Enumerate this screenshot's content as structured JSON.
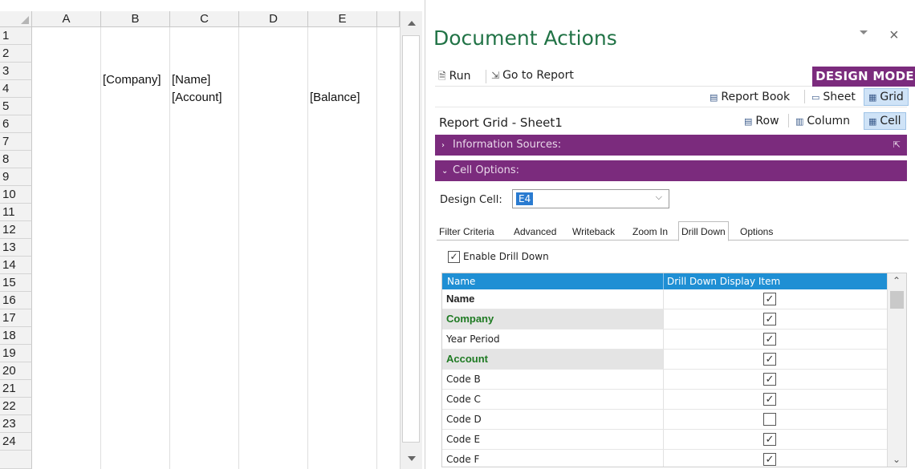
{
  "sheet": {
    "columns": [
      "A",
      "B",
      "C",
      "D",
      "E"
    ],
    "rows": [
      "1",
      "2",
      "3",
      "4",
      "5",
      "6",
      "7",
      "8",
      "9",
      "10",
      "11",
      "12",
      "13",
      "14",
      "15",
      "16",
      "17",
      "18",
      "19",
      "20",
      "21",
      "22",
      "23",
      "24"
    ],
    "cells": {
      "b3": "[Company]",
      "c3": "[Name]",
      "c4": "[Account]",
      "e4": "[Balance]"
    }
  },
  "pane": {
    "title": "Document Actions",
    "close_glyph": "×",
    "toolbar": {
      "run_label": "Run",
      "goto_label": "Go to Report",
      "mode_label": "DESIGN MODE"
    },
    "view": {
      "report_book_label": "Report Book",
      "sheet_label": "Sheet",
      "grid_label": "Grid"
    },
    "grid_header": {
      "title": "Report Grid - Sheet1",
      "row_label": "Row",
      "column_label": "Column",
      "cell_label": "Cell"
    },
    "sections": {
      "info_sources": "Information Sources:",
      "cell_options": "Cell Options:"
    },
    "design_cell": {
      "label": "Design Cell:",
      "value": "E4"
    },
    "tabs": [
      "Filter Criteria",
      "Advanced",
      "Writeback",
      "Zoom In",
      "Drill Down",
      "Options"
    ],
    "selected_tab": "Drill Down",
    "enable_label": "Enable Drill Down",
    "drill_table": {
      "col_name": "Name",
      "col_display": "Drill Down Display Item",
      "rows": [
        {
          "name": "Name",
          "checked": true,
          "style": "bold"
        },
        {
          "name": "Company",
          "checked": true,
          "style": "green"
        },
        {
          "name": "Year Period",
          "checked": true,
          "style": "normal"
        },
        {
          "name": "Account",
          "checked": true,
          "style": "green"
        },
        {
          "name": "Code B",
          "checked": true,
          "style": "normal"
        },
        {
          "name": "Code C",
          "checked": true,
          "style": "normal"
        },
        {
          "name": "Code D",
          "checked": false,
          "style": "normal"
        },
        {
          "name": "Code E",
          "checked": true,
          "style": "normal"
        },
        {
          "name": "Code F",
          "checked": true,
          "style": "normal"
        }
      ]
    }
  },
  "colors": {
    "title_green": "#217346",
    "purple": "#7b2b7d",
    "header_blue": "#1f8fd4",
    "row_green_text": "#1e7a22"
  }
}
